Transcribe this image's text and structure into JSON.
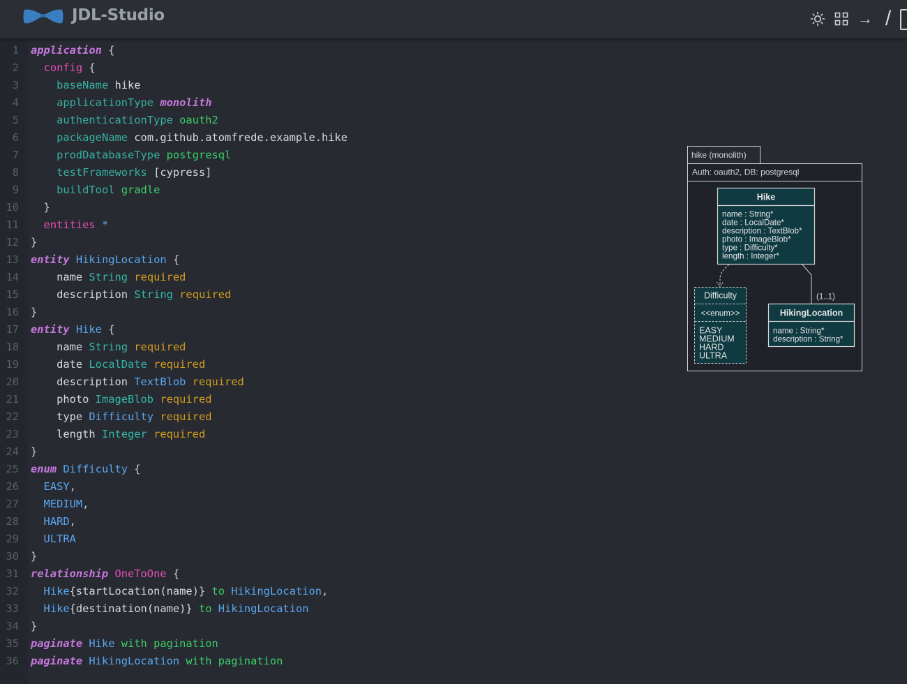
{
  "app": {
    "title": "JDL-Studio"
  },
  "toolbar": {
    "icons": [
      "sun-icon",
      "grid-icon",
      "arrow-right-icon",
      "slash-icon",
      "panel-toggle-icon"
    ],
    "arrow_glyph": "→",
    "slash_glyph": "/"
  },
  "colors": {
    "background": "#272a31",
    "keyword": "#c678dd",
    "property": "#37b0a0",
    "string_value": "#3cd06a",
    "required": "#d39c1e",
    "name": "#5aa7f0",
    "config_pink": "#e84eb7",
    "diagram_box": "#0f3a42",
    "logo_blue": "#3a7ec2"
  },
  "editor": {
    "lines": [
      [
        [
          "application",
          "kw"
        ],
        [
          " {",
          "punct"
        ]
      ],
      [
        [
          "  ",
          "plain"
        ],
        [
          "config",
          "pink"
        ],
        [
          " {",
          "punct"
        ]
      ],
      [
        [
          "    ",
          "plain"
        ],
        [
          "baseName",
          "prop"
        ],
        [
          " hike",
          "val"
        ]
      ],
      [
        [
          "    ",
          "plain"
        ],
        [
          "applicationType",
          "prop"
        ],
        [
          " ",
          "plain"
        ],
        [
          "monolith",
          "kw"
        ]
      ],
      [
        [
          "    ",
          "plain"
        ],
        [
          "authenticationType",
          "prop"
        ],
        [
          " oauth2",
          "green"
        ]
      ],
      [
        [
          "    ",
          "plain"
        ],
        [
          "packageName",
          "prop"
        ],
        [
          " com.github.atomfrede.example.hike",
          "val"
        ]
      ],
      [
        [
          "    ",
          "plain"
        ],
        [
          "prodDatabaseType",
          "prop"
        ],
        [
          " postgresql",
          "green"
        ]
      ],
      [
        [
          "    ",
          "plain"
        ],
        [
          "testFrameworks",
          "prop"
        ],
        [
          " [cypress]",
          "val"
        ]
      ],
      [
        [
          "    ",
          "plain"
        ],
        [
          "buildTool",
          "prop"
        ],
        [
          " gradle",
          "green"
        ]
      ],
      [
        [
          "  }",
          "punct"
        ]
      ],
      [
        [
          "  ",
          "plain"
        ],
        [
          "entities",
          "pink"
        ],
        [
          " *",
          "star"
        ]
      ],
      [
        [
          "}",
          "punct"
        ]
      ],
      [
        [
          "entity",
          "kw"
        ],
        [
          " HikingLocation",
          "name"
        ],
        [
          " {",
          "punct"
        ]
      ],
      [
        [
          "    name ",
          "plain"
        ],
        [
          "String",
          "type"
        ],
        [
          " required",
          "req"
        ]
      ],
      [
        [
          "    description ",
          "plain"
        ],
        [
          "String",
          "type"
        ],
        [
          " required",
          "req"
        ]
      ],
      [
        [
          "}",
          "punct"
        ]
      ],
      [
        [
          "entity",
          "kw"
        ],
        [
          " Hike",
          "name"
        ],
        [
          " {",
          "punct"
        ]
      ],
      [
        [
          "    name ",
          "plain"
        ],
        [
          "String",
          "type"
        ],
        [
          " required",
          "req"
        ]
      ],
      [
        [
          "    date ",
          "plain"
        ],
        [
          "LocalDate",
          "type"
        ],
        [
          " required",
          "req"
        ]
      ],
      [
        [
          "    description ",
          "plain"
        ],
        [
          "TextBlob",
          "name"
        ],
        [
          " required",
          "req"
        ]
      ],
      [
        [
          "    photo ",
          "plain"
        ],
        [
          "ImageBlob",
          "type"
        ],
        [
          " required",
          "req"
        ]
      ],
      [
        [
          "    type ",
          "plain"
        ],
        [
          "Difficulty",
          "name"
        ],
        [
          " required",
          "req"
        ]
      ],
      [
        [
          "    length ",
          "plain"
        ],
        [
          "Integer",
          "type"
        ],
        [
          " required",
          "req"
        ]
      ],
      [
        [
          "}",
          "punct"
        ]
      ],
      [
        [
          "enum",
          "kw"
        ],
        [
          " Difficulty",
          "name"
        ],
        [
          " {",
          "punct"
        ]
      ],
      [
        [
          "  ",
          "plain"
        ],
        [
          "EASY",
          "name"
        ],
        [
          ",",
          "punct"
        ]
      ],
      [
        [
          "  ",
          "plain"
        ],
        [
          "MEDIUM",
          "name"
        ],
        [
          ",",
          "punct"
        ]
      ],
      [
        [
          "  ",
          "plain"
        ],
        [
          "HARD",
          "name"
        ],
        [
          ",",
          "punct"
        ]
      ],
      [
        [
          "  ",
          "plain"
        ],
        [
          "ULTRA",
          "name"
        ]
      ],
      [
        [
          "}",
          "punct"
        ]
      ],
      [
        [
          "relationship",
          "kw"
        ],
        [
          " OneToOne",
          "pink"
        ],
        [
          " {",
          "punct"
        ]
      ],
      [
        [
          "  ",
          "plain"
        ],
        [
          "Hike",
          "name"
        ],
        [
          "{startLocation(name)}",
          "plain"
        ],
        [
          " to",
          "green"
        ],
        [
          " HikingLocation",
          "name"
        ],
        [
          ",",
          "punct"
        ]
      ],
      [
        [
          "  ",
          "plain"
        ],
        [
          "Hike",
          "name"
        ],
        [
          "{destination(name)}",
          "plain"
        ],
        [
          " to",
          "green"
        ],
        [
          " HikingLocation",
          "name"
        ]
      ],
      [
        [
          "}",
          "punct"
        ]
      ],
      [
        [
          "paginate",
          "kw"
        ],
        [
          " Hike",
          "name"
        ],
        [
          " with pagination",
          "green"
        ]
      ],
      [
        [
          "paginate",
          "kw"
        ],
        [
          " HikingLocation",
          "name"
        ],
        [
          " with pagination",
          "green"
        ]
      ]
    ]
  },
  "diagram": {
    "app_tab": "hike (monolith)",
    "app_info": "Auth: oauth2, DB: postgresql",
    "hike": {
      "title": "Hike",
      "fields": [
        "name : String*",
        "date : LocalDate*",
        "description : TextBlob*",
        "photo : ImageBlob*",
        "type : Difficulty*",
        "length : Integer*"
      ]
    },
    "difficulty": {
      "title": "Difficulty",
      "stereotype": "<<enum>>",
      "values": [
        "EASY",
        "MEDIUM",
        "HARD",
        "ULTRA"
      ]
    },
    "hiking_location": {
      "title": "HikingLocation",
      "fields": [
        "name : String*",
        "description : String*"
      ]
    },
    "relation_label": "(1..1)"
  }
}
